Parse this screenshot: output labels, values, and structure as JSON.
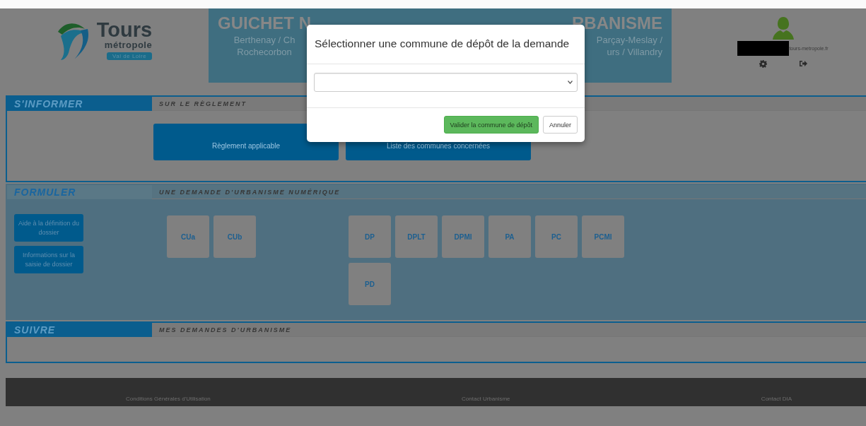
{
  "header": {
    "logo": {
      "name": "Tours",
      "sub": "métropole",
      "tag": "Val de Loire"
    },
    "title_left": "GUICHET N",
    "title_right": "RBANISME",
    "subtitle_left": [
      "Berthenay / Ch",
      "Rochecorbon"
    ],
    "subtitle_right": [
      "Parçay-Meslay /",
      "urs / Villandry"
    ],
    "user": {
      "email": "tours-metropole.fr"
    }
  },
  "sections": [
    {
      "kind": "info",
      "title": "S'INFORMER",
      "subtitle": "SUR LE RÈGLEMENT",
      "cards": [
        "Règlement applicable",
        "Liste des communes concernées"
      ]
    },
    {
      "kind": "form",
      "title": "FORMULER",
      "subtitle": "UNE DEMANDE D'URBANISME NUMÉRIQUE",
      "side_buttons": [
        "Aide à la définition du dossier",
        "Informations sur la saisie de dossier"
      ],
      "tile_groups": [
        [
          "CUa",
          "CUb"
        ],
        [
          "DP",
          "DPLT",
          "DPMI",
          "PA",
          "PC",
          "PCMI",
          "PD"
        ]
      ]
    },
    {
      "kind": "track",
      "title": "SUIVRE",
      "subtitle": "MES DEMANDES D'URBANISME"
    }
  ],
  "footer": {
    "links": [
      "Conditions Générales d'Utilisation",
      "Contact Urbanisme",
      "Contact DIA"
    ]
  },
  "modal": {
    "title": "Sélectionner une commune de dépôt de la demande",
    "buttons": [
      {
        "kind": "primary",
        "label": "Valider la commune de dépôt"
      },
      {
        "kind": "default",
        "label": "Annuler"
      }
    ]
  }
}
